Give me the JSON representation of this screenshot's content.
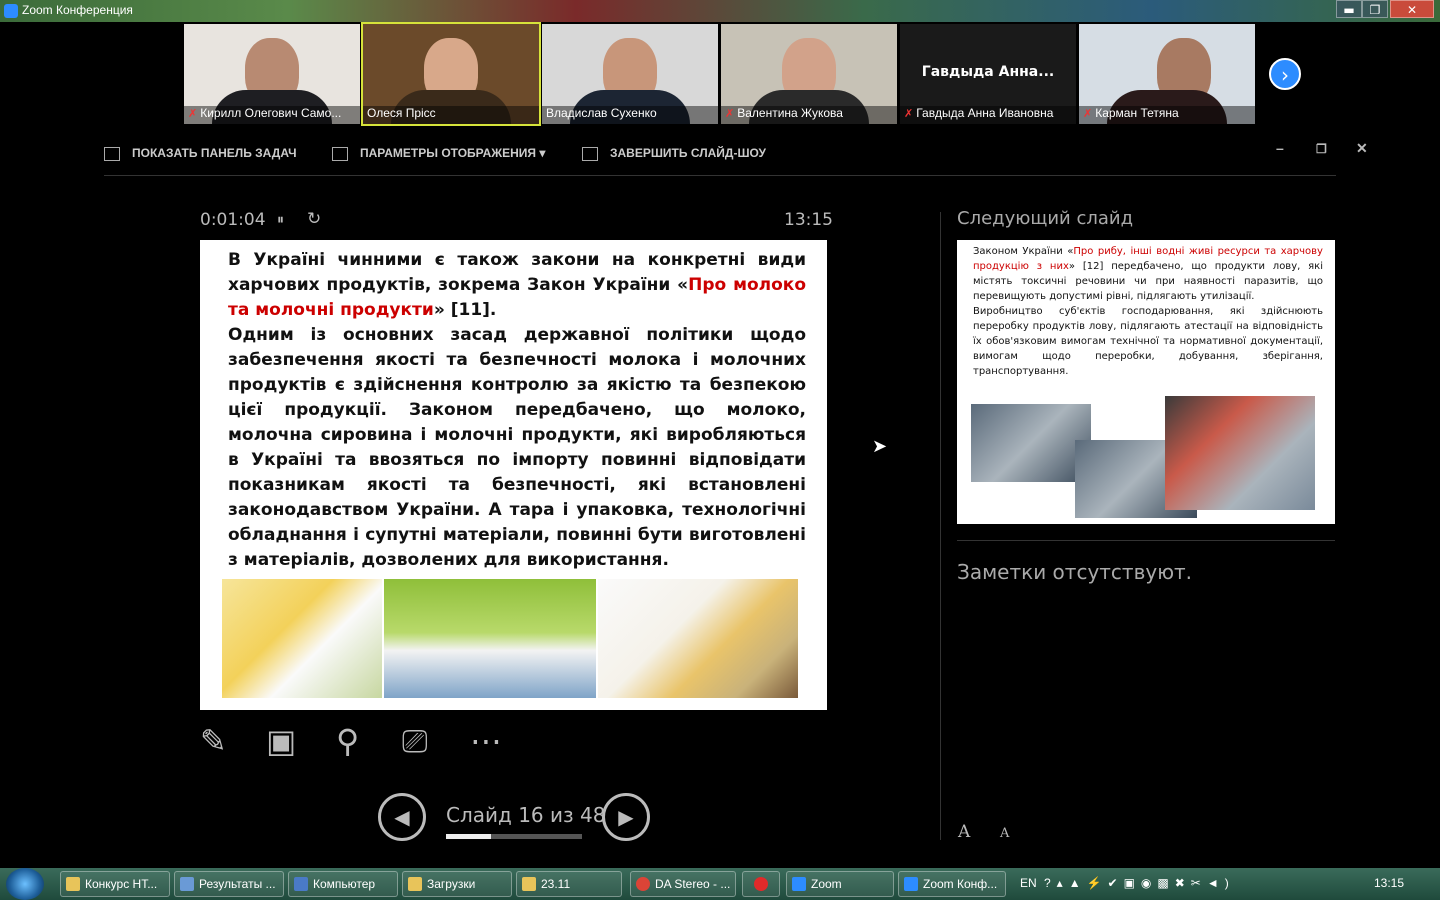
{
  "window": {
    "title": "Zoom Конференция",
    "controls": [
      "▬",
      "❐",
      "✕"
    ]
  },
  "participants": [
    {
      "name": "Кирилл Олегович Само...",
      "muted": true
    },
    {
      "name": "Олеся Пріcс",
      "muted": false,
      "active": true
    },
    {
      "name": "Владислав Сухенко",
      "muted": false
    },
    {
      "name": "Валентина Жукова",
      "muted": true
    },
    {
      "name": "Гавдыда Анна Ивановна",
      "muted": true,
      "display_name": "Гавдыда Анна..."
    },
    {
      "name": "Карман Тетяна",
      "muted": true
    }
  ],
  "toolbar": {
    "show_taskbar": "ПОКАЗАТЬ ПАНЕЛЬ ЗАДАЧ",
    "display_settings": "ПАРАМЕТРЫ ОТОБРАЖЕНИЯ ▾",
    "end_slideshow": "ЗАВЕРШИТЬ СЛАЙД-ШОУ"
  },
  "presenter": {
    "elapsed": "0:01:04",
    "pause_icon": "⏸",
    "reset_icon": "↻",
    "clock": "13:15",
    "slide_counter": "Слайд 16 из 48",
    "progress_fraction": 0.333
  },
  "current_slide": {
    "p1_a": "В Україні чинними є також закони на конкретні види харчових продуктів, зокрема Закон України «",
    "p1_red": "Про молоко та молочні продукти",
    "p1_b": "» [11].",
    "p2": "Одним із основних засад державної політики щодо забезпечення якості та безпечності молока і молочних продуктів є здійснення контролю за якістю та безпекою цієї продукції. Законом передбачено, що молоко, молочна сировина і молочні продукти, які виробляються в Україні та ввозяться по імпорту повинні відповідати показникам якості та безпечності, які встановлені законодавством України. А тара і упаковка, технологічні обладнання і супутні матеріали, повинні бути виготовлені з матеріалів, дозволених для використання."
  },
  "next_slide": {
    "heading": "Следующий слайд",
    "p1_a": "Законом України «",
    "p1_red": "Про рибу, інші водні живі ресурси та харчову продукцію з них",
    "p1_b": "» [12] передбачено, що продукти лову, які містять токсичні речовини чи при наявності паразитів, що перевищують допустимі рівні, підлягають утилізації.",
    "p2": "Виробництво суб'єктів господарювання, які здійснюють переробку продуктів лову, підлягають атестації на відповідність їх обов'язковим вимогам технічної та нормативної документації, вимогам щодо переробки, добування, зберігання, транспортування."
  },
  "notes": {
    "text": "Заметки отсутствуют.",
    "increase": "A",
    "decrease": "A"
  },
  "tools": [
    "pen-icon",
    "grid-icon",
    "zoom-icon",
    "screen-icon",
    "more-icon"
  ],
  "taskbar": {
    "items": [
      "Конкурс НТ...",
      "Результаты ...",
      "Компьютер",
      "Загрузки",
      "23.11",
      "DA Stereo - ...",
      "",
      "Zoom",
      "Zoom Конф..."
    ],
    "lang": "EN",
    "clock": "13:15"
  }
}
